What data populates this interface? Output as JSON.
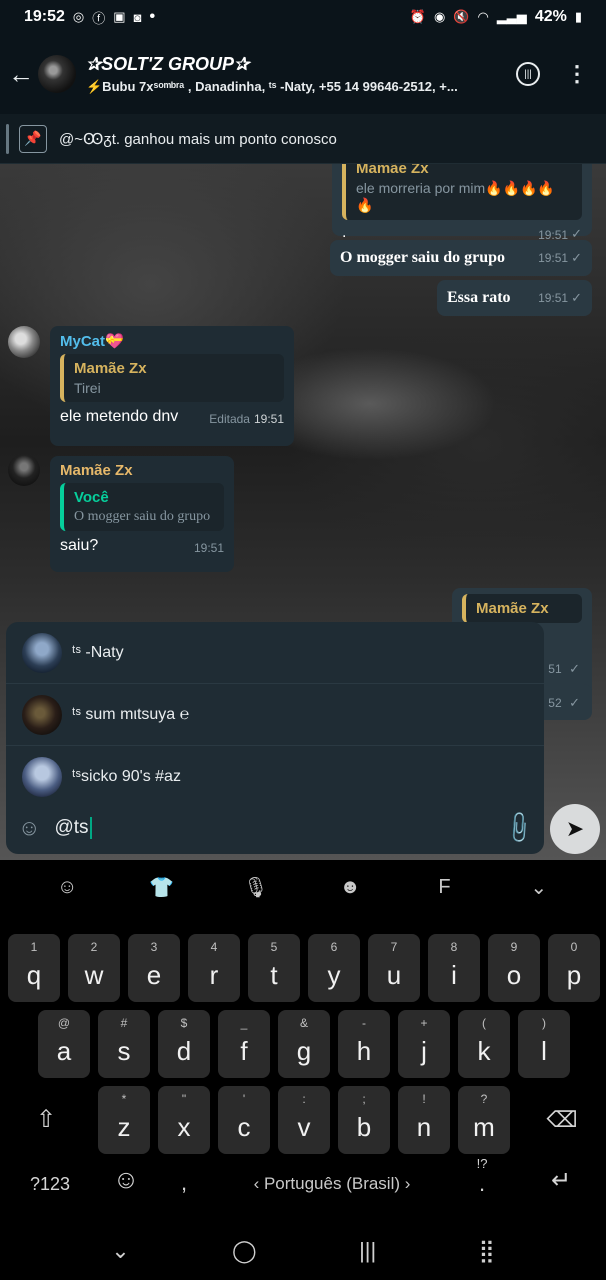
{
  "status_bar": {
    "time": "19:52",
    "battery": "42%",
    "dot": "•"
  },
  "header": {
    "title": "✰SOLT'Z GROUP✰",
    "subtitle": "⚡Bubu 7xˢᵒᵐᵇʳᵃ , Danadinha, ᵗˢ -Naty, +55 14 99646-2512, +..."
  },
  "pinned": {
    "text": "@~Ꙭᵹt. ganhou mais um ponto conosco"
  },
  "messages": {
    "m1": {
      "quote_name": "Mamãe Zx",
      "quote_text": "ele morreria por mim🔥🔥🔥🔥🔥",
      "text": ".",
      "time": "19:51"
    },
    "m2": {
      "text": "O mogger saiu do grupo",
      "time": "19:51"
    },
    "m3": {
      "text": "Essa rato",
      "time": "19:51"
    },
    "m4": {
      "sender": "MyCat💝",
      "quote_name": "Mamãe Zx",
      "quote_text": "Tirei",
      "text": "ele metendo dnv",
      "edited": "Editada",
      "time": "19:51"
    },
    "m5": {
      "sender": "Mamãe Zx",
      "quote_name": "Você",
      "quote_text": "O mogger saiu do grupo",
      "text": "saiu?",
      "time": "19:51"
    },
    "m6": {
      "quote_name": "Mamãe Zx",
      "time_a": "51",
      "time_b": "52"
    }
  },
  "mentions": [
    {
      "name": "ᵗˢ -Naty"
    },
    {
      "name": "ᵗˢ sum mιtsuya ℮"
    },
    {
      "name": "ᵗˢsicko 90's #az"
    }
  ],
  "input": {
    "value": "@ts"
  },
  "keyboard": {
    "row1": [
      {
        "n": "1",
        "c": "q"
      },
      {
        "n": "2",
        "c": "w"
      },
      {
        "n": "3",
        "c": "e"
      },
      {
        "n": "4",
        "c": "r"
      },
      {
        "n": "5",
        "c": "t"
      },
      {
        "n": "6",
        "c": "y"
      },
      {
        "n": "7",
        "c": "u"
      },
      {
        "n": "8",
        "c": "i"
      },
      {
        "n": "9",
        "c": "o"
      },
      {
        "n": "0",
        "c": "p"
      }
    ],
    "row2": [
      {
        "n": "@",
        "c": "a"
      },
      {
        "n": "#",
        "c": "s"
      },
      {
        "n": "$",
        "c": "d"
      },
      {
        "n": "_",
        "c": "f"
      },
      {
        "n": "&",
        "c": "g"
      },
      {
        "n": "-",
        "c": "h"
      },
      {
        "n": "+",
        "c": "j"
      },
      {
        "n": "(",
        "c": "k"
      },
      {
        "n": ")",
        "c": "l"
      }
    ],
    "row3": [
      {
        "n": "*",
        "c": "z"
      },
      {
        "n": "\"",
        "c": "x"
      },
      {
        "n": "'",
        "c": "c"
      },
      {
        "n": ":",
        "c": "v"
      },
      {
        "n": ";",
        "c": "b"
      },
      {
        "n": "!",
        "c": "n"
      },
      {
        "n": "?",
        "c": "m"
      }
    ],
    "symbols_label": "?123",
    "comma": ",",
    "period": ".",
    "period_alt": "!?",
    "space_label": "Português (Brasil)"
  }
}
